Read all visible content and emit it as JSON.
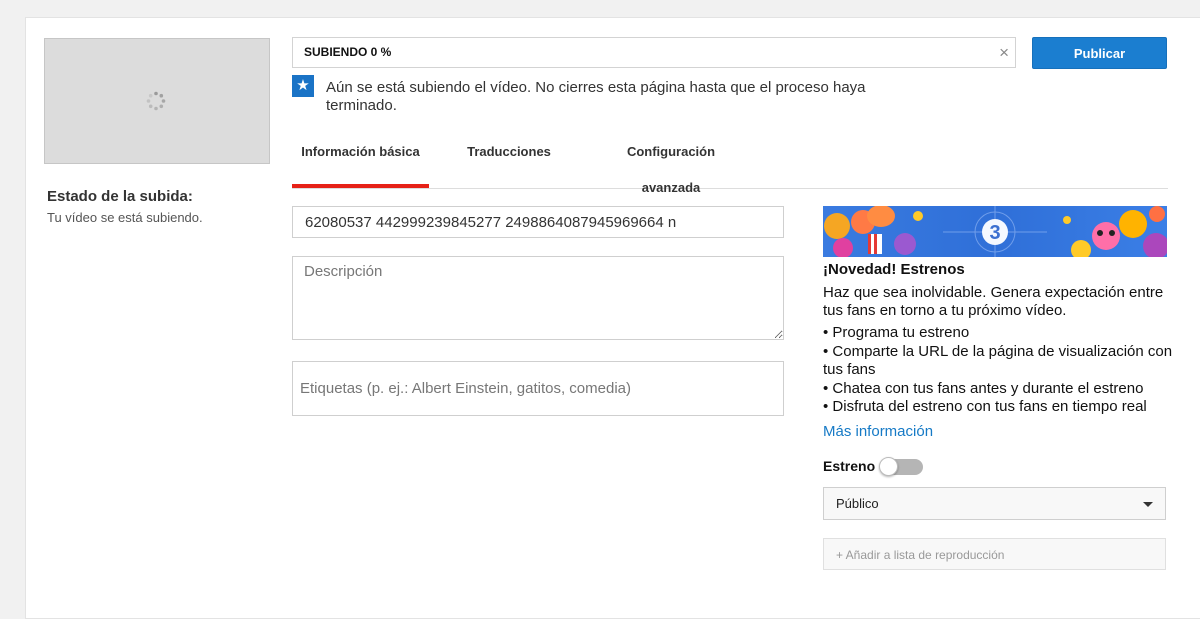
{
  "upload": {
    "progress_text": "SUBIENDO 0 %",
    "progress_fraction": 0,
    "close_symbol": "×",
    "status_label": "Estado de la subida:",
    "status_text": "Tu vídeo se está subiendo."
  },
  "toolbar": {
    "publish_label": "Publicar"
  },
  "notice": {
    "icon": "star-icon",
    "icon_glyph": "★",
    "text": "Aún se está subiendo el vídeo. No cierres esta página hasta que el proceso haya terminado."
  },
  "tabs": [
    {
      "label": "Información básica",
      "active": true
    },
    {
      "label": "Traducciones",
      "active": false
    },
    {
      "label": "Configuración avanzada",
      "active": false
    }
  ],
  "form": {
    "title_value": "62080537 442999239845277 2498864087945969664 n",
    "description_placeholder": "Descripción",
    "tags_placeholder": "Etiquetas (p. ej.: Albert Einstein, gatitos, comedia)"
  },
  "premiere": {
    "countdown_number": "3",
    "title": "¡Novedad! Estrenos",
    "description": "Haz que sea inolvidable. Genera expectación entre tus fans en torno a tu próximo vídeo.",
    "bullets": [
      "• Programa tu estreno",
      "• Comparte la URL de la página de visualización con tus fans",
      "• Chatea con tus fans antes y durante el estreno",
      "• Disfruta del estreno con tus fans en tiempo real"
    ],
    "more_link": "Más información",
    "toggle_label": "Estreno",
    "toggle_on": false
  },
  "privacy": {
    "selected": "Público"
  },
  "playlist": {
    "label": "+ Añadir a lista de reproducción"
  },
  "colors": {
    "accent_blue": "#1b7ed0",
    "tab_underline": "#e62117",
    "link": "#167ac6",
    "banner_bg": "#2b6fd6"
  }
}
